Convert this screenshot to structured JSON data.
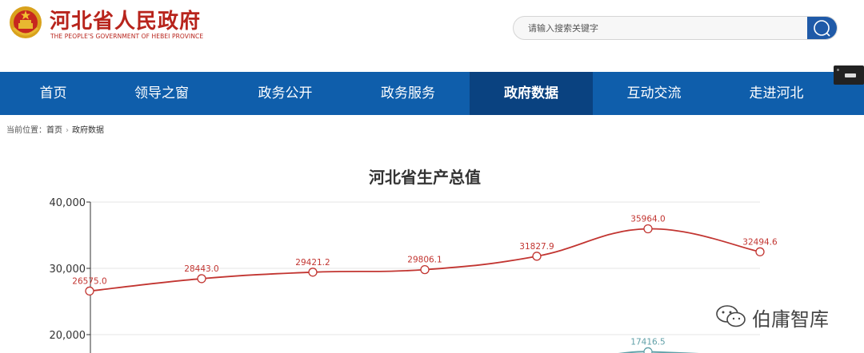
{
  "header": {
    "site_title": "河北省人民政府",
    "site_subtitle": "THE PEOPLE'S GOVERNMENT OF HEBEI PROVINCE",
    "search_placeholder": "请输入搜索关键字"
  },
  "nav": {
    "items": [
      {
        "label": "首页",
        "active": false
      },
      {
        "label": "领导之窗",
        "active": false
      },
      {
        "label": "政务公开",
        "active": false
      },
      {
        "label": "政务服务",
        "active": false
      },
      {
        "label": "政府数据",
        "active": true
      },
      {
        "label": "互动交流",
        "active": false
      },
      {
        "label": "走进河北",
        "active": false
      }
    ]
  },
  "breadcrumb": {
    "prefix": "当前位置：",
    "items": [
      "首页",
      "政府数据"
    ]
  },
  "colors": {
    "brand_red": "#b8241c",
    "nav_blue": "#0f5eab",
    "nav_active": "#0a4280",
    "series_red": "#c23531",
    "series_teal": "#61a0a8"
  },
  "chart_data": {
    "type": "line",
    "title": "河北省生产总值",
    "y_ticks": [
      "40,000",
      "30,000",
      "20,000"
    ],
    "ylim": [
      20000,
      40000
    ],
    "grid": true,
    "smooth": true,
    "series": [
      {
        "color": "#c23531",
        "values": [
          26575.0,
          28443.0,
          29421.2,
          29806.1,
          31827.9,
          35964.0,
          32494.6
        ],
        "labels": [
          "26575.0",
          "28443.0",
          "29421.2",
          "29806.1",
          "31827.9",
          "35964.0",
          "32494.6"
        ]
      },
      {
        "color": "#61a0a8",
        "partial": true,
        "values": [
          null,
          null,
          null,
          null,
          null,
          17416.5,
          null
        ],
        "labels": [
          "",
          "",
          "",
          "",
          "",
          "17416.5",
          ""
        ]
      }
    ]
  },
  "watermark": {
    "text": "伯庸智库",
    "icon": "wechat-icon"
  }
}
